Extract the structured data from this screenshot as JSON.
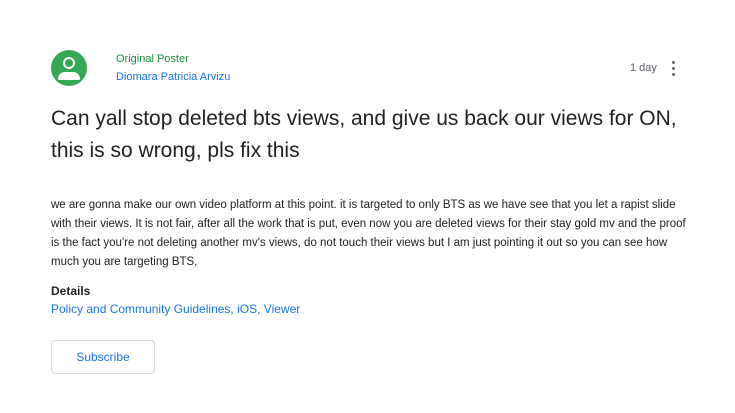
{
  "poster": {
    "role": "Original Poster",
    "name": "Diomara Patricia Arvizu",
    "avatar_icon": "account-circle-icon",
    "avatar_color": "#34a853"
  },
  "meta": {
    "timestamp": "1 day",
    "more_icon": "more-vert-icon"
  },
  "post": {
    "title": "Can yall stop deleted bts views, and give us back our views for ON, this is so wrong, pls fix this",
    "body": "we are gonna make our own video platform at this point. it is targeted to only BTS as we have see that you let a rapist slide with their views. It is not fair, after all the work that is put, even now you are deleted views for their stay gold mv and the proof is the fact you're not deleting another mv's views, do not touch their views but I am just pointing it out so you can see how much you are targeting BTS,"
  },
  "details": {
    "heading": "Details",
    "links": [
      "Policy and Community Guidelines",
      "iOS",
      "Viewer"
    ],
    "separator": ", "
  },
  "actions": {
    "subscribe_label": "Subscribe"
  },
  "colors": {
    "role": "#1e8e3e",
    "link": "#1a73e8",
    "text": "#202124",
    "muted": "#5f6368"
  }
}
